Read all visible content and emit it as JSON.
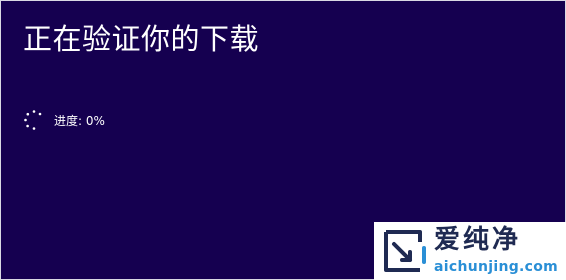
{
  "installer": {
    "heading": "正在验证你的下载",
    "progress_text": "进度: 0%",
    "progress_value": 0,
    "spinner_icon": "loading-spinner-icon"
  },
  "watermark": {
    "brand_cn": "爱纯净",
    "url": "aichunjing.com",
    "logo_icon": "aichunjing-logo-icon"
  },
  "colors": {
    "background": "#150050",
    "text": "#ffffff",
    "watermark_brand": "#1f2a52",
    "watermark_url": "#2a8fd6"
  }
}
